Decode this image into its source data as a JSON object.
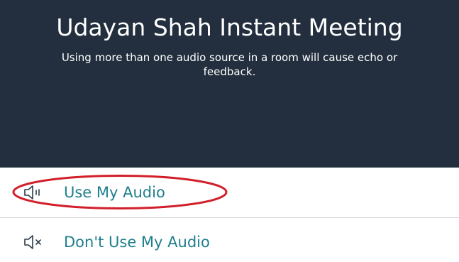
{
  "header": {
    "title": "Udayan Shah Instant Meeting",
    "subtitle": "Using more than one audio source in a room will cause echo or feedback."
  },
  "options": [
    {
      "label": "Use My Audio",
      "icon": "speaker-icon"
    },
    {
      "label": "Don't Use My Audio",
      "icon": "speaker-muted-icon"
    }
  ],
  "colors": {
    "header_bg": "#232f3e",
    "link": "#1f7f8c",
    "highlight": "#d21f2a",
    "divider": "#d5d9d9"
  }
}
